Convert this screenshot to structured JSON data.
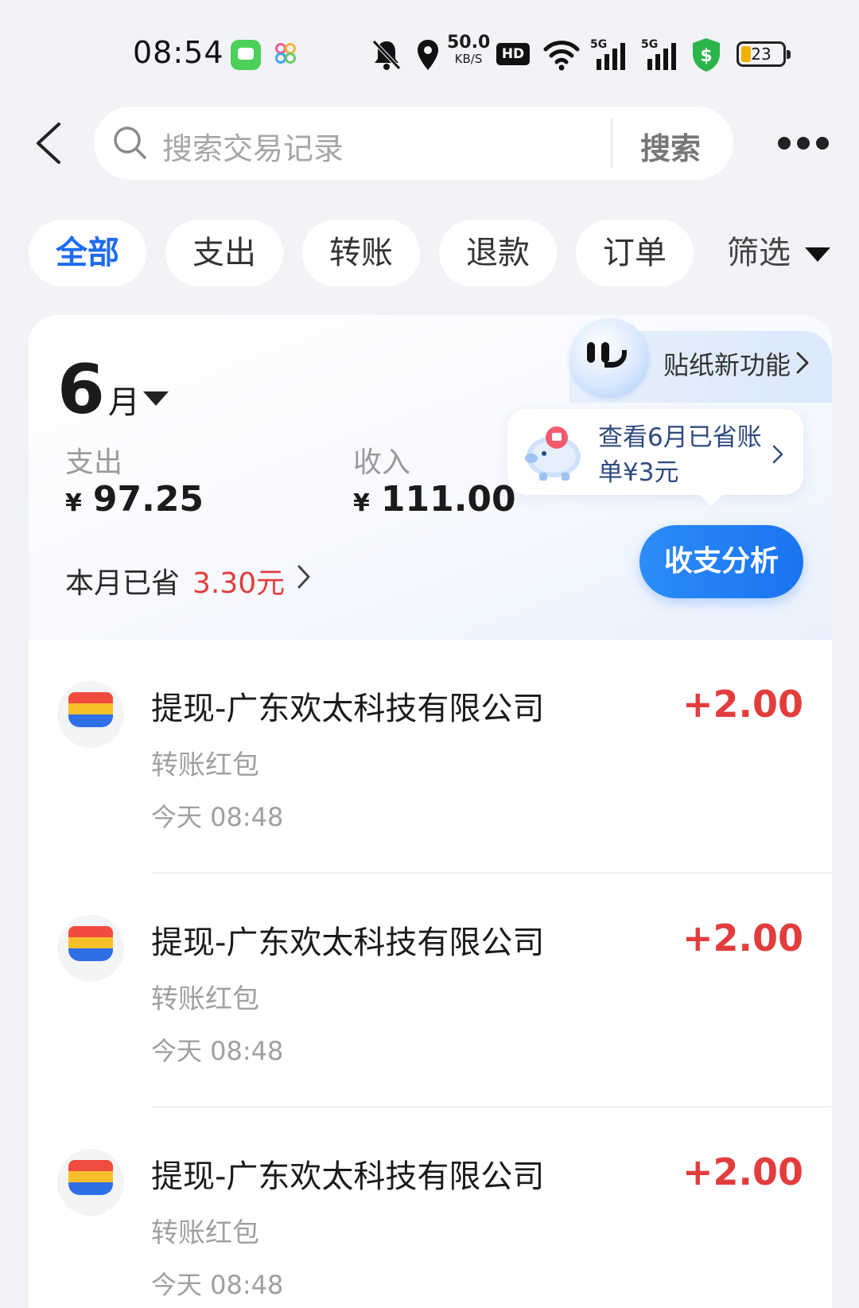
{
  "status_bar": {
    "time": "08:54",
    "speed_value": "50.0",
    "speed_unit": "KB/S",
    "hd_label": "HD",
    "signal1": "5G",
    "signal2": "5G",
    "battery": "23",
    "icons": [
      "chat-app-icon",
      "photos-app-icon",
      "bell-muted-icon",
      "location-icon",
      "wifi-icon",
      "signal-icon",
      "shield-icon",
      "battery-icon"
    ]
  },
  "header": {
    "search_placeholder": "搜索交易记录",
    "search_button": "搜索"
  },
  "tabs": [
    {
      "label": "全部",
      "active": true
    },
    {
      "label": "支出",
      "active": false
    },
    {
      "label": "转账",
      "active": false
    },
    {
      "label": "退款",
      "active": false
    },
    {
      "label": "订单",
      "active": false
    }
  ],
  "filter_label": "筛选",
  "sticker_banner": "贴纸新功能",
  "summary": {
    "month_num": "6",
    "month_unit": "月",
    "expense_label": "支出",
    "currency": "¥",
    "expense_amount": "97.25",
    "income_label": "收入",
    "income_amount": "111.00",
    "saved_label": "本月已省",
    "saved_amount": "3.30元",
    "bubble_text": "查看6月已省账单¥3元",
    "analysis_button": "收支分析"
  },
  "transactions": [
    {
      "title": "提现-广东欢太科技有限公司",
      "category": "转账红包",
      "time": "今天 08:48",
      "amount": "+2.00"
    },
    {
      "title": "提现-广东欢太科技有限公司",
      "category": "转账红包",
      "time": "今天 08:48",
      "amount": "+2.00"
    },
    {
      "title": "提现-广东欢太科技有限公司",
      "category": "转账红包",
      "time": "今天 08:48",
      "amount": "+2.00"
    }
  ],
  "colors": {
    "accent_blue": "#1e6bef",
    "amount_red": "#e23d3d",
    "background": "#f2f3f7"
  }
}
